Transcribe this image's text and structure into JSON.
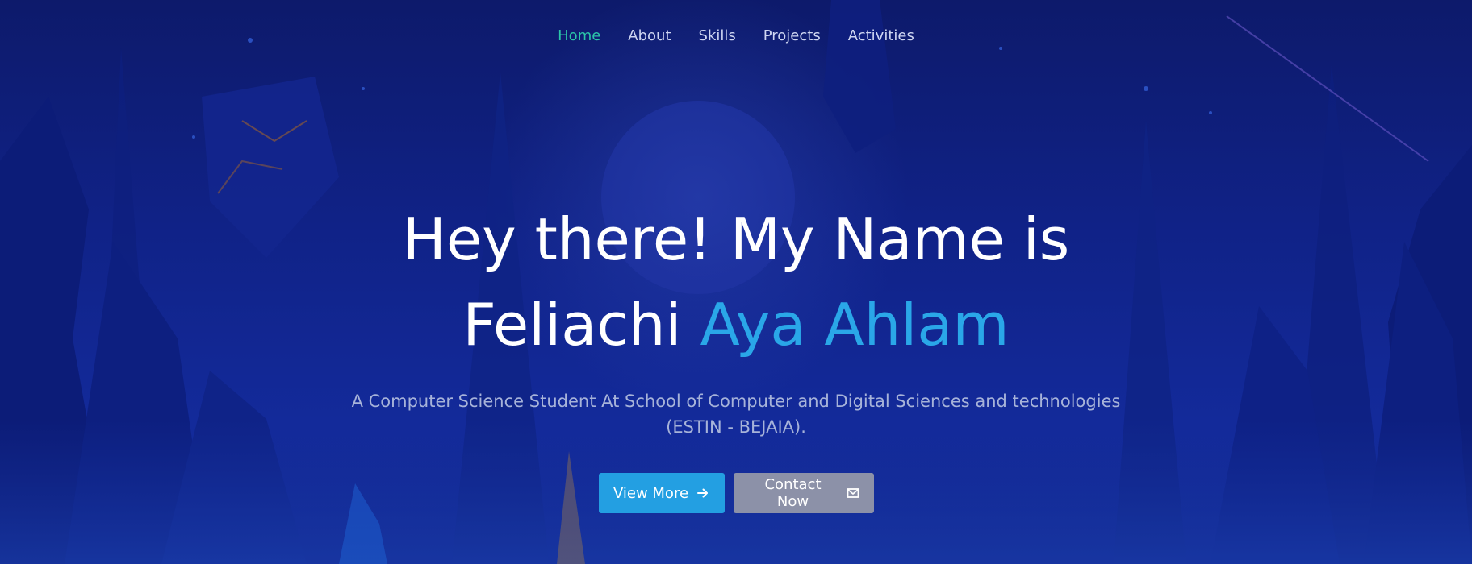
{
  "nav": {
    "items": [
      {
        "label": "Home",
        "active": true
      },
      {
        "label": "About",
        "active": false
      },
      {
        "label": "Skills",
        "active": false
      },
      {
        "label": "Projects",
        "active": false
      },
      {
        "label": "Activities",
        "active": false
      }
    ]
  },
  "hero": {
    "headline_line1": "Hey there! My Name is",
    "headline_name_first": "Feliachi",
    "headline_name_accent": "Aya Ahlam",
    "subtitle": "A Computer Science Student At School of Computer and Digital Sciences and technologies (ESTIN - BEJAIA).",
    "buttons": {
      "view_more": {
        "label": "View More",
        "icon": "arrow-right-icon"
      },
      "contact_now": {
        "label": "Contact Now",
        "icon": "mail-icon"
      }
    }
  },
  "colors": {
    "nav_active": "#2bc4a8",
    "accent": "#2aa7e8",
    "primary_button": "#239fe2",
    "secondary_button": "#8c91a8",
    "background": "#102287"
  }
}
